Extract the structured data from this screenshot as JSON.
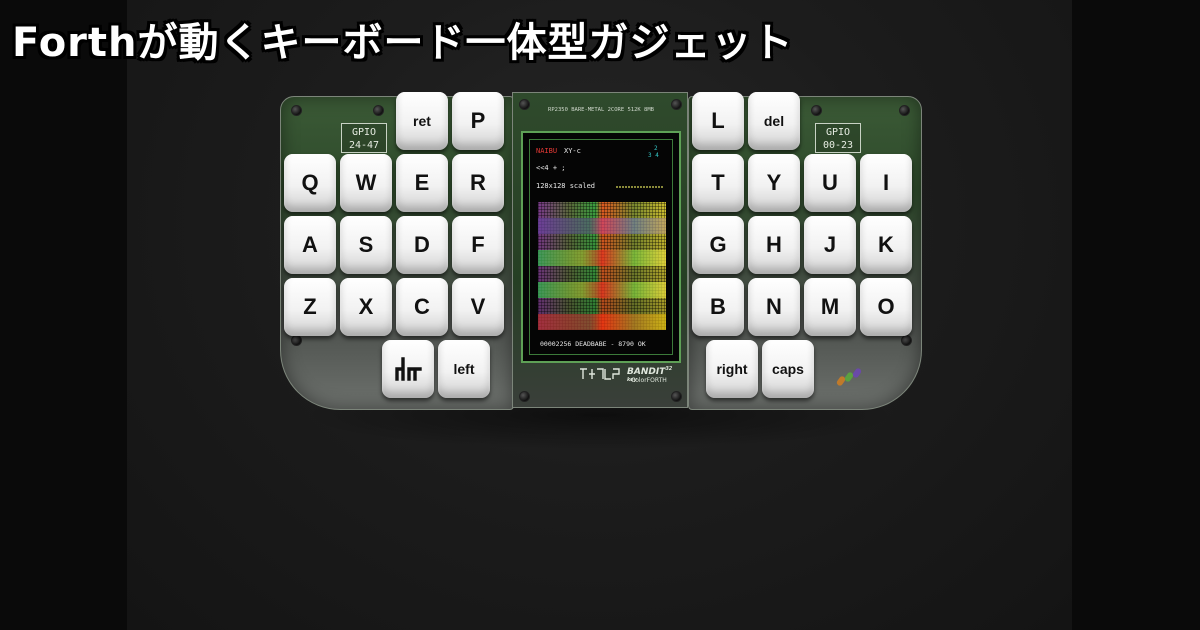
{
  "headline": "Forthが動くキーボード一体型ガジェット",
  "device": {
    "gpio_left": [
      "GPIO",
      "24-47"
    ],
    "gpio_right": [
      "GPIO",
      "00-23"
    ],
    "board_label": "RP2350 BARE-METAL  2CORE  512K  8MB",
    "screen": {
      "row1_mode": "NAIBU",
      "row1_text": "XY-c",
      "row1_digits": [
        "2",
        "3 4"
      ],
      "row2_text": "<<4  + ;",
      "row3_text": "128x128 scaled",
      "footer_text": "00002256 DEADBABE - 8790 OK"
    },
    "logo_brand": "BANDIT",
    "logo_brand_sup": "32 key",
    "logo_sub": "ColorFORTH"
  },
  "keys": {
    "left": {
      "row0": [
        "ret",
        "P"
      ],
      "row1": [
        "Q",
        "W",
        "E",
        "R"
      ],
      "row2": [
        "A",
        "S",
        "D",
        "F"
      ],
      "row3": [
        "Z",
        "X",
        "C",
        "V"
      ],
      "thumb": [
        "left"
      ]
    },
    "right": {
      "row0": [
        "L",
        "del"
      ],
      "row1": [
        "T",
        "Y",
        "U",
        "I"
      ],
      "row2": [
        "G",
        "H",
        "J",
        "K"
      ],
      "row3": [
        "B",
        "N",
        "M",
        "O"
      ],
      "thumb": [
        "right",
        "caps"
      ]
    }
  },
  "colors": {
    "pcb_green": "#2e4a2b",
    "screen_border": "#5ea056",
    "key_white": "#f2f2f2",
    "headline": "#ffffff"
  },
  "icons": {
    "thumb_left_symbol": "forth-glyph-icon"
  }
}
